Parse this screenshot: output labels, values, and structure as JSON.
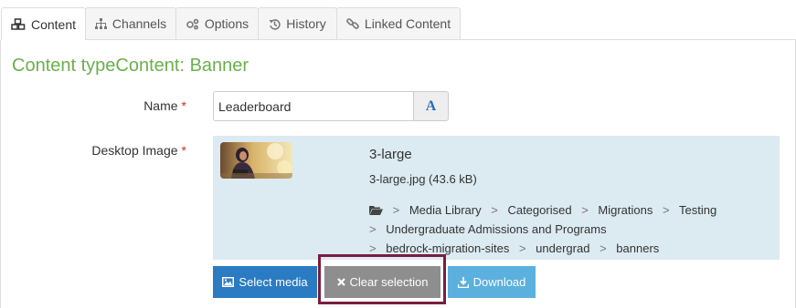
{
  "tabs": [
    {
      "label": "Content",
      "icon": "cubes-icon"
    },
    {
      "label": "Channels",
      "icon": "sitemap-icon"
    },
    {
      "label": "Options",
      "icon": "cogs-icon"
    },
    {
      "label": "History",
      "icon": "history-icon"
    },
    {
      "label": "Linked Content",
      "icon": "link-icon"
    }
  ],
  "page": {
    "title": "Content typeContent: Banner"
  },
  "form": {
    "name_label": "Name",
    "required_mark": "*",
    "name_value": "Leaderboard",
    "name_addon": "A",
    "desktop_image_label": "Desktop Image"
  },
  "media": {
    "title": "3-large",
    "file": "3-large.jpg (43.6 kB)",
    "path": [
      "Media Library",
      "Categorised",
      "Migrations",
      "Testing",
      "Undergraduate Admissions and Programs",
      "bedrock-migration-sites",
      "undergrad",
      "banners"
    ],
    "separator": ">"
  },
  "buttons": {
    "select": "Select media",
    "clear": "Clear selection",
    "download": "Download"
  },
  "colors": {
    "title_green": "#6ab04c",
    "select_blue": "#2b7bc2",
    "clear_gray": "#8e8e8e",
    "download_blue": "#5bb0de",
    "highlight": "#7b1d3e",
    "media_bg": "#dceaf2"
  }
}
